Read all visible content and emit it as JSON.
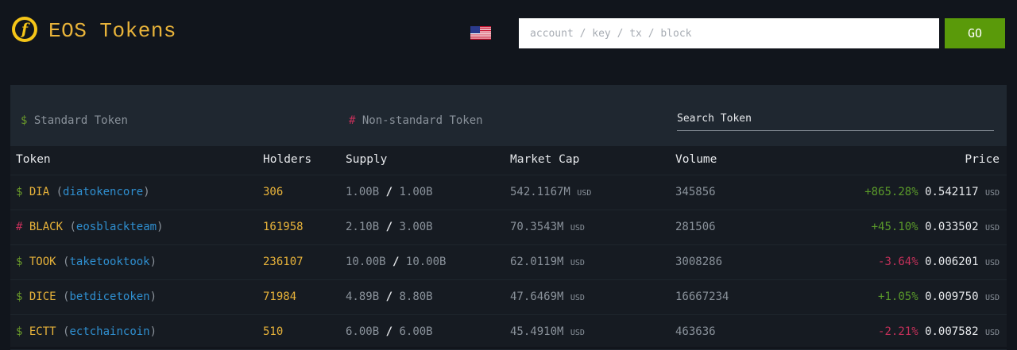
{
  "header": {
    "logo_letter": "f",
    "title": "EOS Tokens",
    "flag_icon": "us-flag-icon",
    "search_placeholder": "account / key / tx / block",
    "search_value": "",
    "go_label": "GO"
  },
  "filters": {
    "standard_symbol": "$",
    "standard_label": "Standard Token",
    "nonstandard_symbol": "#",
    "nonstandard_label": "Non-standard Token",
    "token_search_placeholder": "Search Token"
  },
  "table": {
    "headers": {
      "token": "Token",
      "holders": "Holders",
      "supply": "Supply",
      "market_cap": "Market Cap",
      "volume": "Volume",
      "price": "Price"
    },
    "rows": [
      {
        "symbol": "$",
        "name": "DIA",
        "open": "(",
        "account": "diatokencore",
        "close": ")",
        "holders": "306",
        "supply_circ": "1.00B",
        "supply_sep": "/",
        "supply_max": "1.00B",
        "mcap": "542.1167M",
        "mcap_unit": "USD",
        "volume": "345856",
        "change": "+865.28%",
        "price": "0.542117",
        "price_unit": "USD"
      },
      {
        "symbol": "#",
        "name": "BLACK",
        "open": "(",
        "account": "eosblackteam",
        "close": ")",
        "holders": "161958",
        "supply_circ": "2.10B",
        "supply_sep": "/",
        "supply_max": "3.00B",
        "mcap": "70.3543M",
        "mcap_unit": "USD",
        "volume": "281506",
        "change": "+45.10%",
        "price": "0.033502",
        "price_unit": "USD"
      },
      {
        "symbol": "$",
        "name": "TOOK",
        "open": "(",
        "account": "taketooktook",
        "close": ")",
        "holders": "236107",
        "supply_circ": "10.00B",
        "supply_sep": "/",
        "supply_max": "10.00B",
        "mcap": "62.0119M",
        "mcap_unit": "USD",
        "volume": "3008286",
        "change": "-3.64%",
        "price": "0.006201",
        "price_unit": "USD"
      },
      {
        "symbol": "$",
        "name": "DICE",
        "open": "(",
        "account": "betdicetoken",
        "close": ")",
        "holders": "71984",
        "supply_circ": "4.89B",
        "supply_sep": "/",
        "supply_max": "8.80B",
        "mcap": "47.6469M",
        "mcap_unit": "USD",
        "volume": "16667234",
        "change": "+1.05%",
        "price": "0.009750",
        "price_unit": "USD"
      },
      {
        "symbol": "$",
        "name": "ECTT",
        "open": "(",
        "account": "ectchaincoin",
        "close": ")",
        "holders": "510",
        "supply_circ": "6.00B",
        "supply_sep": "/",
        "supply_max": "6.00B",
        "mcap": "45.4910M",
        "mcap_unit": "USD",
        "volume": "463636",
        "change": "-2.21%",
        "price": "0.007582",
        "price_unit": "USD"
      }
    ]
  },
  "colors": {
    "background": "#11151c",
    "accent_gold": "#e8b33a",
    "link_blue": "#2f8fd0",
    "positive": "#5a9a2a",
    "negative": "#c4305a",
    "go_button": "#5a9a0a"
  }
}
